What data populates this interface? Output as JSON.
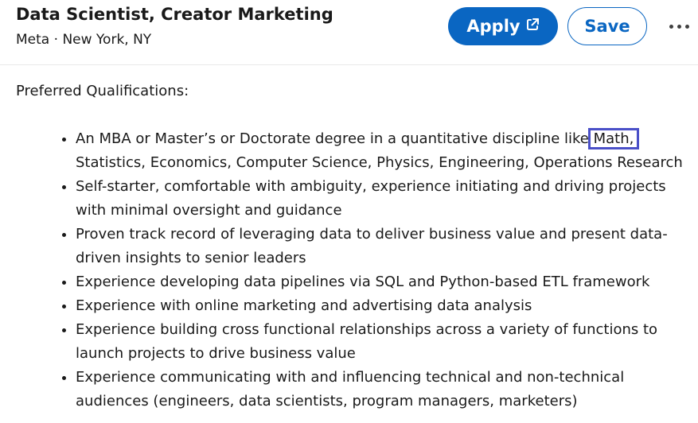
{
  "header": {
    "title": "Data Scientist, Creator Marketing",
    "company": "Meta",
    "separator": "·",
    "location": "New York, NY",
    "apply_label": "Apply",
    "apply_icon": "external-link-icon",
    "save_label": "Save",
    "more_icon": "more-horizontal-icon"
  },
  "section": {
    "heading": "Preferred Qualifications:",
    "items": [
      {
        "pre": "An MBA or Master’s or Doctorate degree in a quantitative discipline like ",
        "highlight": "Math,",
        "post": " Statistics, Economics, Computer Science, Physics, Engineering, Operations Research"
      },
      {
        "text": "Self-starter, comfortable with ambiguity, experience initiating and driving projects with minimal oversight and guidance"
      },
      {
        "text": "Proven track record of leveraging data to deliver business value and present data-driven insights to senior leaders"
      },
      {
        "text": "Experience developing data pipelines via SQL and Python-based ETL framework"
      },
      {
        "text": "Experience with online marketing and advertising data analysis"
      },
      {
        "text": "Experience building cross functional relationships across a variety of functions to launch projects to drive business value"
      },
      {
        "text": "Experience communicating with and influencing technical and non-technical audiences (engineers, data scientists, program managers, marketers)"
      }
    ]
  },
  "colors": {
    "primary": "#0a66c2",
    "highlight_box": "#4a50c8"
  }
}
